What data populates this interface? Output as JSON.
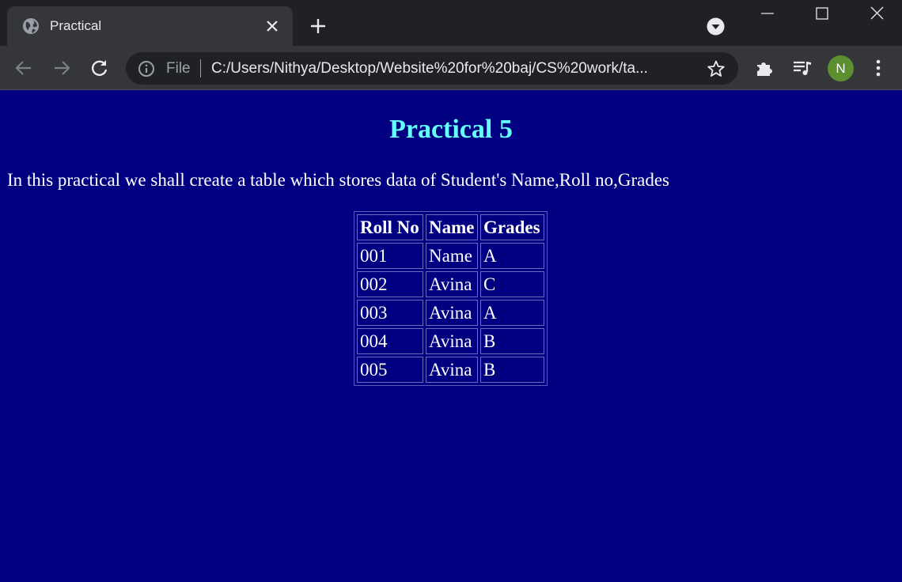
{
  "browser": {
    "tab_title": "Practical",
    "address_scheme": "File",
    "address_url": "C:/Users/Nithya/Desktop/Website%20for%20baj/CS%20work/ta...",
    "profile_initial": "N",
    "colors": {
      "titlebar": "#202124",
      "toolbar": "#35363a",
      "avatar": "#5b8f2f"
    }
  },
  "page": {
    "title": "Practical 5",
    "intro": "In this practical we shall create a table which stores data of Student's Name,Roll no,Grades",
    "table": {
      "headers": [
        "Roll No",
        "Name",
        "Grades"
      ],
      "rows": [
        [
          "001",
          "Name",
          "A"
        ],
        [
          "002",
          "Avina",
          "C"
        ],
        [
          "003",
          "Avina",
          "A"
        ],
        [
          "004",
          "Avina",
          "B"
        ],
        [
          "005",
          "Avina",
          "B"
        ]
      ]
    },
    "colors": {
      "background": "#000080",
      "heading": "#66ffff",
      "text": "#ffffff"
    }
  },
  "icons": [
    "globe-icon",
    "tab-close-icon",
    "new-tab-icon",
    "tab-search-icon",
    "minimize-icon",
    "maximize-icon",
    "window-close-icon",
    "back-icon",
    "forward-icon",
    "reload-icon",
    "info-icon",
    "bookmark-star-icon",
    "extensions-icon",
    "media-controls-icon",
    "menu-kebab-icon"
  ]
}
